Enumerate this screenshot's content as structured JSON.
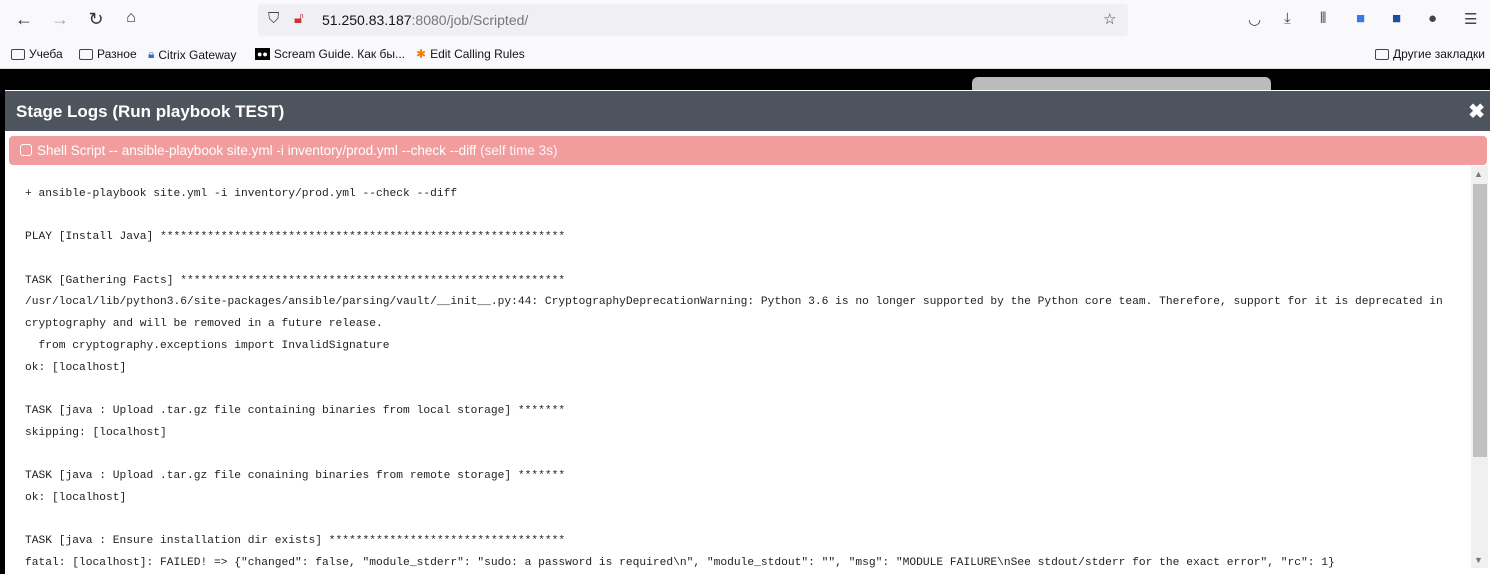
{
  "browser": {
    "url_host": "51.250.83.187",
    "url_rest": ":8080/job/Scripted/",
    "bookmarks": [
      {
        "label": "Учеба",
        "icon": "folder-icon"
      },
      {
        "label": "Разное",
        "icon": "folder-icon"
      },
      {
        "label": "Citrix Gateway",
        "icon": "lock-icon"
      },
      {
        "label": "Scream Guide. Как бы...",
        "icon": "medium-icon"
      },
      {
        "label": "Edit Calling Rules",
        "icon": "asterisk-icon"
      }
    ],
    "other_bookmarks": "Другие закладки"
  },
  "modal": {
    "title": "Stage Logs (Run playbook TEST)",
    "close": "✖",
    "step": {
      "label": "Shell Script -- ansible-playbook site.yml -i inventory/prod.yml --check --diff",
      "time": "(self time 3s)",
      "color": "#f29d9d"
    },
    "log_lines": [
      "+ ansible-playbook site.yml -i inventory/prod.yml --check --diff",
      "",
      "PLAY [Install Java] ************************************************************",
      "",
      "TASK [Gathering Facts] *********************************************************",
      "/usr/local/lib/python3.6/site-packages/ansible/parsing/vault/__init__.py:44: CryptographyDeprecationWarning: Python 3.6 is no longer supported by the Python core team. Therefore, support for it is deprecated in",
      "cryptography and will be removed in a future release.",
      "  from cryptography.exceptions import InvalidSignature",
      "ok: [localhost]",
      "",
      "TASK [java : Upload .tar.gz file containing binaries from local storage] *******",
      "skipping: [localhost]",
      "",
      "TASK [java : Upload .tar.gz file conaining binaries from remote storage] *******",
      "ok: [localhost]",
      "",
      "TASK [java : Ensure installation dir exists] ***********************************",
      "fatal: [localhost]: FAILED! => {\"changed\": false, \"module_stderr\": \"sudo: a password is required\\n\", \"module_stdout\": \"\", \"msg\": \"MODULE FAILURE\\nSee stdout/stderr for the exact error\", \"rc\": 1}"
    ]
  }
}
